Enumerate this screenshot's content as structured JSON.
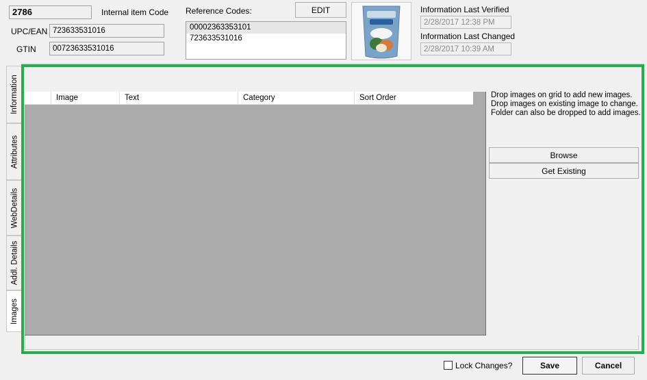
{
  "header": {
    "item_number": "2786",
    "internal_code_label": "Internal item Code",
    "upc_label": "UPC/EAN",
    "upc_value": "723633531016",
    "gtin_label": "GTIN",
    "gtin_value": "00723633531016",
    "reference_codes_label": "Reference Codes:",
    "edit_label": "EDIT",
    "reference_codes": [
      "00002363353101",
      "723633531016"
    ],
    "product_image_icon": "product-pouch-icon",
    "verified_label": "Information Last Verified",
    "verified_value": "2/28/2017 12:38 PM",
    "changed_label": "Information Last Changed",
    "changed_value": "2/28/2017 10:39 AM"
  },
  "tabs": [
    {
      "label": "Information",
      "active": false
    },
    {
      "label": "Attributes",
      "active": false
    },
    {
      "label": "WebDetails",
      "active": false
    },
    {
      "label": "Addl. Details",
      "active": false
    },
    {
      "label": "Images",
      "active": true
    }
  ],
  "grid": {
    "columns": [
      "Image",
      "Text",
      "Category",
      "Sort Order"
    ]
  },
  "side_panel": {
    "instructions": "Drop images on grid to add new images.\nDrop images on existing image to change.\nFolder can also be dropped to add images.",
    "browse_label": "Browse",
    "get_existing_label": "Get Existing"
  },
  "footer": {
    "lock_label": "Lock Changes?",
    "lock_checked": false,
    "save_label": "Save",
    "cancel_label": "Cancel"
  },
  "colors": {
    "highlight_border": "#22b04a",
    "grid_body": "#ababab"
  }
}
